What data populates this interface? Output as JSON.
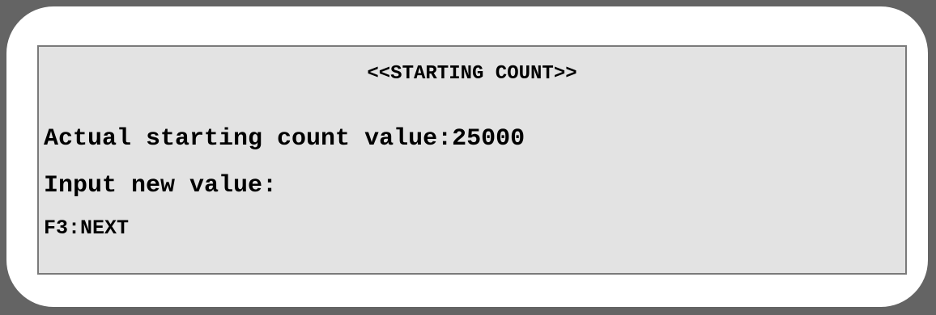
{
  "screen": {
    "title": "<<STARTING COUNT>>",
    "actual_label": "Actual starting count value:",
    "actual_value": "25000",
    "input_label": "Input new value:",
    "input_value": "",
    "function_key": "F3:NEXT"
  },
  "colors": {
    "frame": "#646464",
    "bezel": "#ffffff",
    "screen_bg": "#e3e3e3",
    "text": "#000000"
  }
}
